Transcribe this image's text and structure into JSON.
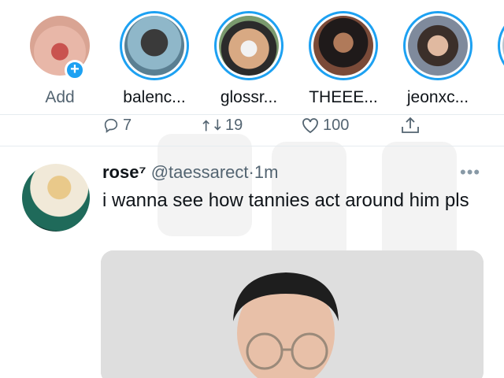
{
  "fleets": [
    {
      "label": "Add",
      "kind": "add"
    },
    {
      "label": "balenc...",
      "kind": "story"
    },
    {
      "label": "glossr...",
      "kind": "story"
    },
    {
      "label": "THEEE...",
      "kind": "story"
    },
    {
      "label": "jeonxc...",
      "kind": "story"
    }
  ],
  "prev_tweet_actions": {
    "reply_count": "7",
    "retweet_count": "19",
    "like_count": "100"
  },
  "tweet": {
    "name": "rose⁷",
    "handle": "@taessarect",
    "separator": "·",
    "time": "1m",
    "text": "i wanna see how tannies act around him pls",
    "more_label": "•••"
  },
  "colors": {
    "accent": "#1da1f2",
    "secondary_text": "#536471",
    "divider": "#e6ecf0"
  },
  "icons": [
    "reply-icon",
    "retweet-icon",
    "like-icon",
    "share-icon",
    "add-plus-icon",
    "more-icon"
  ]
}
